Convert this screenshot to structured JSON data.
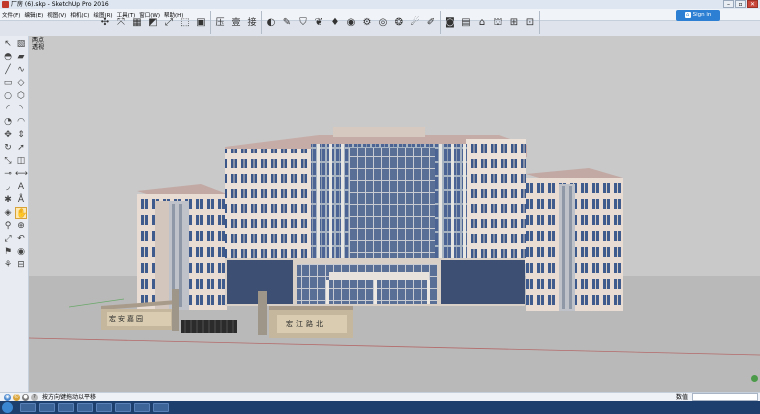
{
  "window": {
    "title": "厂房 (6).skp - SketchUp Pro 2016"
  },
  "menu": {
    "items": [
      "文件(F)",
      "编辑(E)",
      "视图(V)",
      "相机(C)",
      "绘图(R)",
      "工具(T)",
      "窗口(W)",
      "帮助(H)"
    ]
  },
  "toolbar": {
    "text_buttons": [
      "压",
      "壹",
      "接"
    ]
  },
  "signin": {
    "label": "Sign in"
  },
  "viewport": {
    "scene_label_1": "两点",
    "scene_label_2": "透视",
    "gate_sign_left": "宏安嘉园",
    "gate_sign_right": "宏江路北",
    "sky_color": "#c9c9c9",
    "ground_color": "#b7b7b7"
  },
  "status": {
    "message": "按方向键拖动以平移",
    "value_label": "数值",
    "value": ""
  },
  "taskbar": {
    "tray_time": ""
  }
}
